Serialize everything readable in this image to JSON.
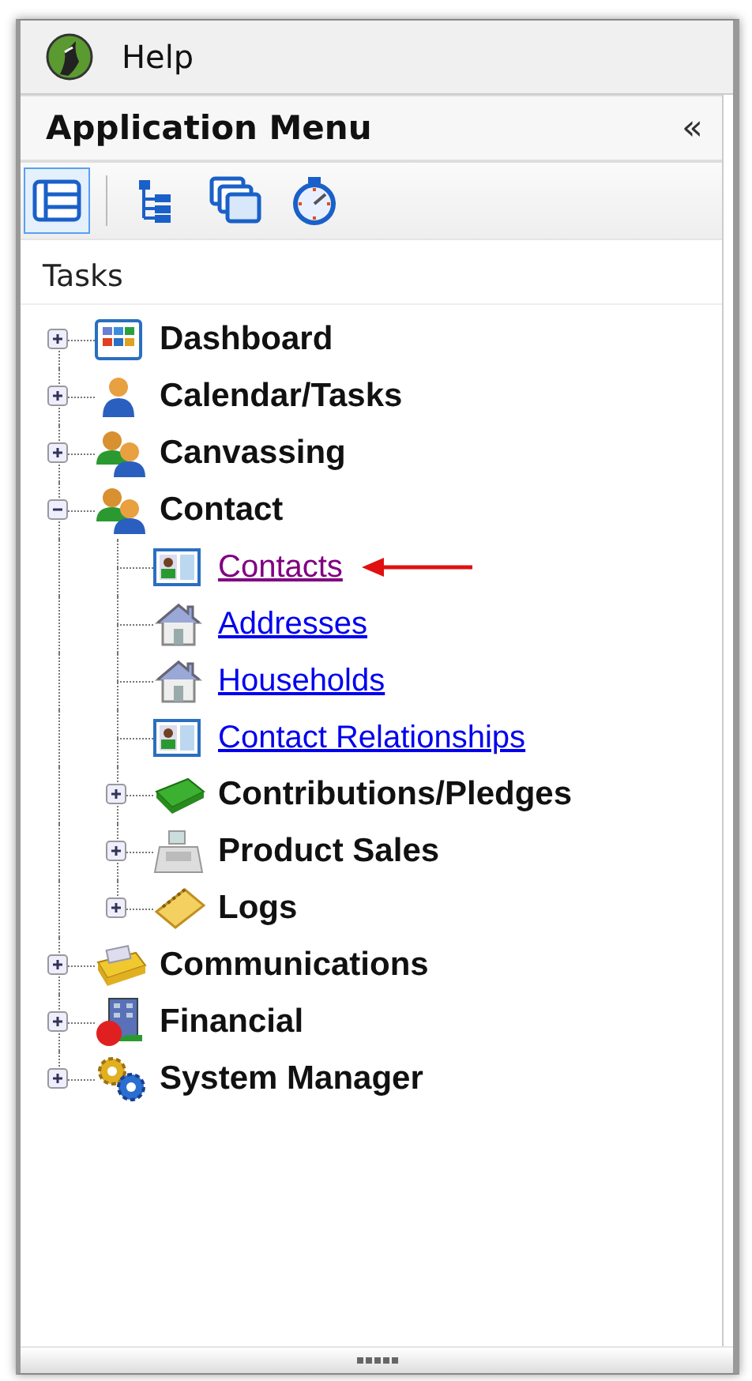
{
  "menu_bar": {
    "items": [
      "Help"
    ]
  },
  "panel": {
    "title": "Application Menu",
    "collapse": "«"
  },
  "toolbar": [
    {
      "selected": true
    },
    {
      "selected": false
    },
    {
      "selected": false
    },
    {
      "selected": false
    }
  ],
  "section": "Tasks",
  "tree": [
    {
      "label": "Dashboard",
      "kind": "group",
      "expanded": false
    },
    {
      "label": "Calendar/Tasks",
      "kind": "group",
      "expanded": false
    },
    {
      "label": "Canvassing",
      "kind": "group",
      "expanded": false
    },
    {
      "label": "Contact",
      "kind": "group",
      "expanded": true,
      "children": [
        {
          "label": "Contacts",
          "kind": "link",
          "visited": true,
          "pointed": true
        },
        {
          "label": "Addresses",
          "kind": "link",
          "visited": false,
          "pointed": false
        },
        {
          "label": "Households",
          "kind": "link",
          "visited": false,
          "pointed": false
        },
        {
          "label": "Contact Relationships",
          "kind": "link",
          "visited": false,
          "pointed": false
        },
        {
          "label": "Contributions/Pledges",
          "kind": "group",
          "expanded": false
        },
        {
          "label": "Product Sales",
          "kind": "group",
          "expanded": false
        },
        {
          "label": "Logs",
          "kind": "group",
          "expanded": false
        }
      ]
    },
    {
      "label": "Communications",
      "kind": "group",
      "expanded": false
    },
    {
      "label": "Financial",
      "kind": "group",
      "expanded": false
    },
    {
      "label": "System Manager",
      "kind": "group",
      "expanded": false
    }
  ]
}
